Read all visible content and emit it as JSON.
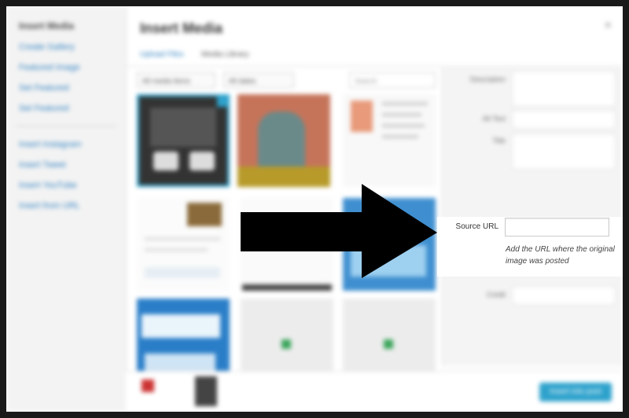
{
  "window": {
    "title": "Insert Media",
    "close_glyph": "×"
  },
  "menu": {
    "title": "Insert Media",
    "items": [
      "Create Gallery",
      "Featured Image",
      "Set Featured",
      "Set Featured"
    ],
    "items2": [
      "Insert Instagram",
      "Insert Tweet",
      "Insert YouTube",
      "Insert from URL"
    ]
  },
  "tabs": [
    {
      "label": "Upload Files",
      "active": true
    },
    {
      "label": "Media Library",
      "active": false
    }
  ],
  "toolbar": {
    "filter1": "All media items",
    "filter2": "All dates",
    "search_placeholder": "Search"
  },
  "details": {
    "field_labels": [
      "Description",
      "Alt Text",
      "Title",
      "Credit"
    ],
    "source_url": {
      "label": "Source URL",
      "value": "",
      "help": "Add the URL where the original image was posted"
    }
  },
  "footer": {
    "insert_label": "Insert into post"
  },
  "colors": {
    "accent": "#2c7fc0",
    "button": "#2ea2cc",
    "overlay": "#000000"
  },
  "icons": {
    "arrow": "right-arrow-icon",
    "close": "close-icon"
  }
}
